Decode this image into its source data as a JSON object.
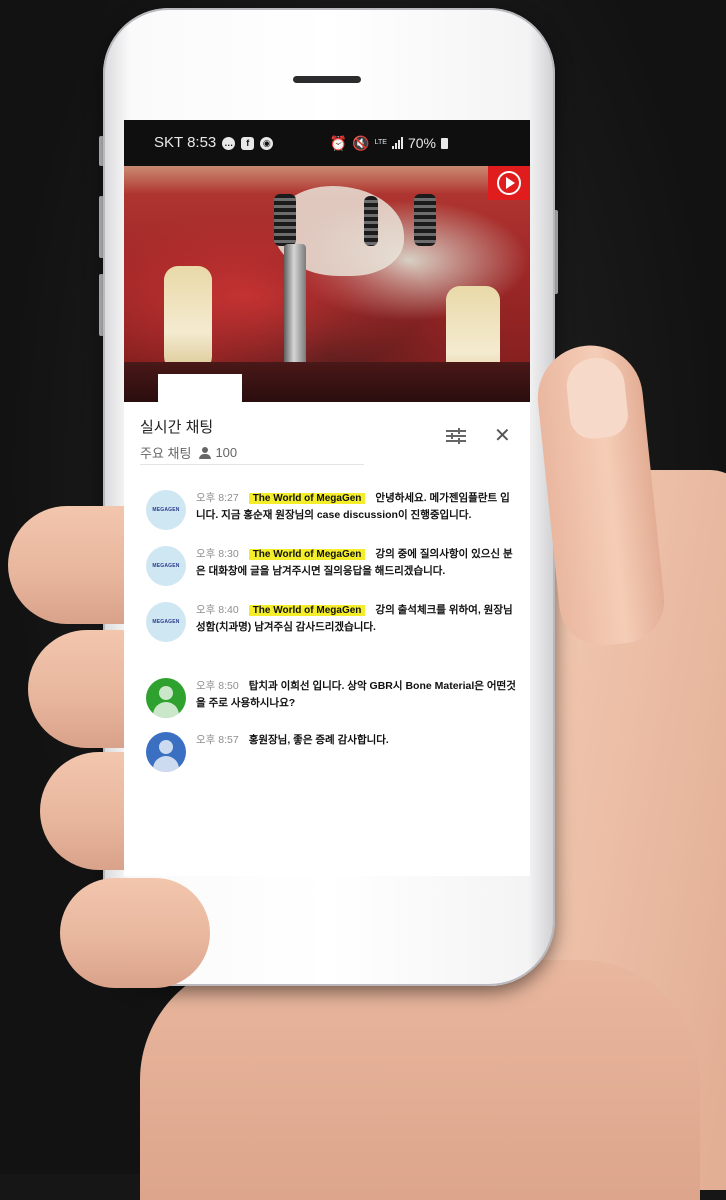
{
  "status_bar": {
    "carrier_time": "SKT 8:53",
    "battery": "70%"
  },
  "chat": {
    "title": "실시간 채팅",
    "mode": "주요 채팅",
    "viewer_count": "100"
  },
  "messages": [
    {
      "time": "오후 8:27",
      "author": "The World of MegaGen",
      "text": "안녕하세요. 메가젠임플란트 입니다. 지금 홍순재 원장님의 case discussion이 진행중입니다.",
      "avatar": "megagen-logo"
    },
    {
      "time": "오후 8:30",
      "author": "The World of MegaGen",
      "text": "강의 중에 질의사항이 있으신 분은 대화창에 글을 남겨주시면 질의응답을 해드리겠습니다.",
      "avatar": "megagen-logo"
    },
    {
      "time": "오후 8:40",
      "author": "The World of MegaGen",
      "text": "강의 출석체크를 위하여, 원장님 성함(치과명) 남겨주심 감사드리겠습니다.",
      "avatar": "megagen-logo"
    },
    {
      "time": "오후 8:50",
      "author": "",
      "text": "탑치과 이희선 입니다. 상악 GBR시 Bone Material은 어떤것을 주로 사용하시나요?",
      "avatar": "default-green"
    },
    {
      "time": "오후 8:57",
      "author": "",
      "text": "홍원장님, 좋은 증례 감사합니다.",
      "avatar": "default-blue"
    }
  ],
  "logo_text": "MEGAGEN",
  "colors": {
    "author_highlight": "#f4ee2a",
    "play_button": "#e01c1c",
    "avatar_green": "#2fa12f",
    "avatar_blue": "#3b6fc2"
  }
}
